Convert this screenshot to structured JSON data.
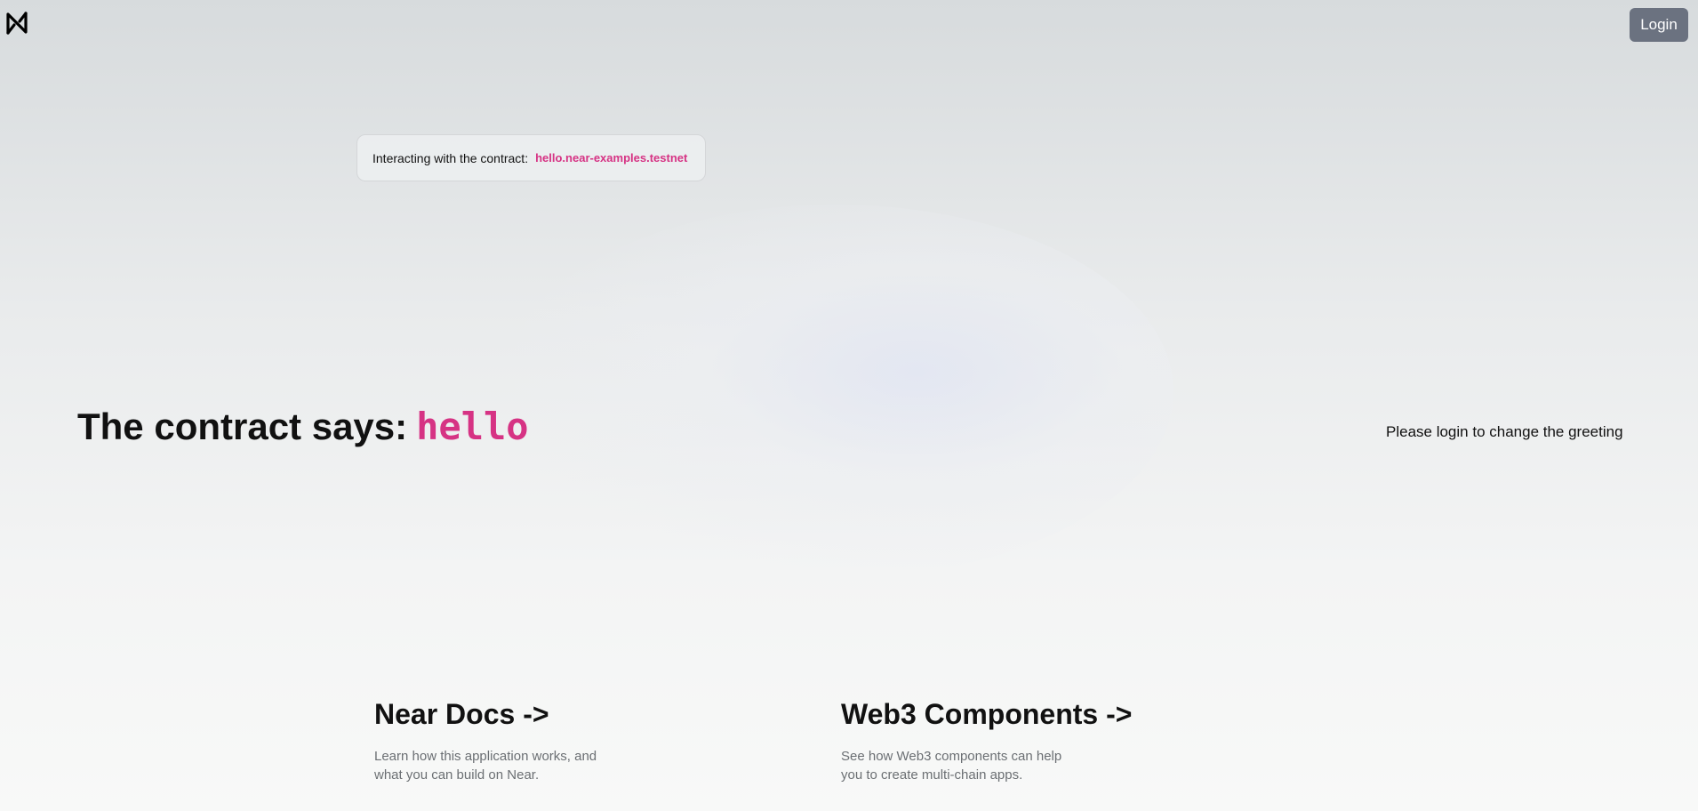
{
  "navbar": {
    "logo_icon": "near-logo-icon",
    "login_label": "Login"
  },
  "contract": {
    "label": "Interacting with the contract:",
    "id": "hello.near-examples.testnet"
  },
  "greeting": {
    "prefix": "The contract says:",
    "value": "hello",
    "login_hint": "Please login to change the greeting"
  },
  "cards": [
    {
      "title": "Near Docs ->",
      "description": "Learn how this application works, and what you can build on Near."
    },
    {
      "title": "Web3 Components ->",
      "description": "See how Web3 components can help you to create multi-chain apps."
    }
  ],
  "colors": {
    "accent": "#d63384",
    "button_bg": "#6b7280",
    "muted_text": "#6b6f73"
  }
}
